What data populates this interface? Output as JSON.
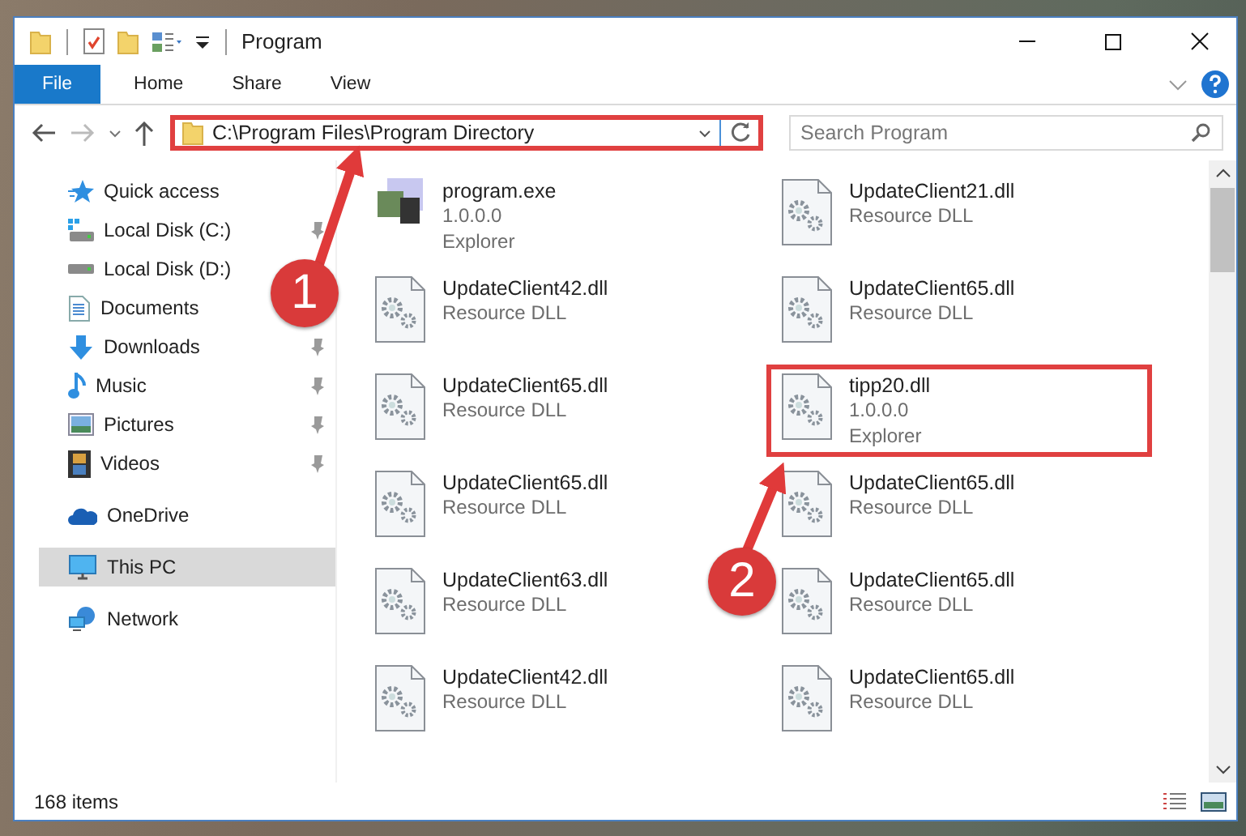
{
  "window": {
    "title": "Program"
  },
  "ribbon": {
    "tabs": [
      {
        "label": "File",
        "kind": "menu",
        "selected": false
      },
      {
        "label": "Home",
        "kind": "tab",
        "selected": false
      },
      {
        "label": "Share",
        "kind": "tab",
        "selected": false
      },
      {
        "label": "View",
        "kind": "tab",
        "selected": false
      }
    ]
  },
  "address": {
    "path": "C:\\Program Files\\Program Directory",
    "highlighted": true
  },
  "search": {
    "placeholder": "Search Program"
  },
  "nav": {
    "items": [
      {
        "label": "Quick access",
        "pinned": false,
        "selected": false,
        "children": [
          {
            "label": "Local Disk (C:)",
            "pinned": true,
            "selected": false
          },
          {
            "label": "Local Disk (D:)",
            "pinned": false,
            "selected": false
          },
          {
            "label": "Documents",
            "pinned": false,
            "selected": false
          },
          {
            "label": "Downloads",
            "pinned": true,
            "selected": false
          },
          {
            "label": "Music",
            "pinned": true,
            "selected": false
          },
          {
            "label": "Pictures",
            "pinned": true,
            "selected": false
          },
          {
            "label": "Videos",
            "pinned": true,
            "selected": false
          }
        ]
      },
      {
        "label": "OneDrive",
        "pinned": false,
        "selected": false
      },
      {
        "label": "This PC",
        "pinned": false,
        "selected": true
      },
      {
        "label": "Network",
        "pinned": false,
        "selected": false
      }
    ]
  },
  "files": [
    {
      "name": "program.exe",
      "kind": "exe",
      "details": [
        "1.0.0.0",
        "Explorer"
      ],
      "highlighted": false
    },
    {
      "name": "UpdateClient21.dll",
      "kind": "dll",
      "details": [
        "Resource DLL"
      ],
      "highlighted": false
    },
    {
      "name": "UpdateClient42.dll",
      "kind": "dll",
      "details": [
        "Resource DLL"
      ],
      "highlighted": false
    },
    {
      "name": "UpdateClient65.dll",
      "kind": "dll",
      "details": [
        "Resource DLL"
      ],
      "highlighted": false
    },
    {
      "name": "UpdateClient65.dll",
      "kind": "dll",
      "details": [
        "Resource DLL"
      ],
      "highlighted": false
    },
    {
      "name": "tipp20.dll",
      "kind": "dll",
      "details": [
        "1.0.0.0",
        "Explorer"
      ],
      "highlighted": true
    },
    {
      "name": "UpdateClient65.dll",
      "kind": "dll",
      "details": [
        "Resource DLL"
      ],
      "highlighted": false
    },
    {
      "name": "UpdateClient65.dll",
      "kind": "dll",
      "details": [
        "Resource DLL"
      ],
      "highlighted": false
    },
    {
      "name": "UpdateClient63.dll",
      "kind": "dll",
      "details": [
        "Resource DLL"
      ],
      "highlighted": false
    },
    {
      "name": "UpdateClient65.dll",
      "kind": "dll",
      "details": [
        "Resource DLL"
      ],
      "highlighted": false
    },
    {
      "name": "UpdateClient42.dll",
      "kind": "dll",
      "details": [
        "Resource DLL"
      ],
      "highlighted": false
    },
    {
      "name": "UpdateClient65.dll",
      "kind": "dll",
      "details": [
        "Resource DLL"
      ],
      "highlighted": false
    }
  ],
  "status_bar": {
    "count": "168 items"
  },
  "annotations": [
    {
      "number": "1"
    },
    {
      "number": "2"
    }
  ]
}
